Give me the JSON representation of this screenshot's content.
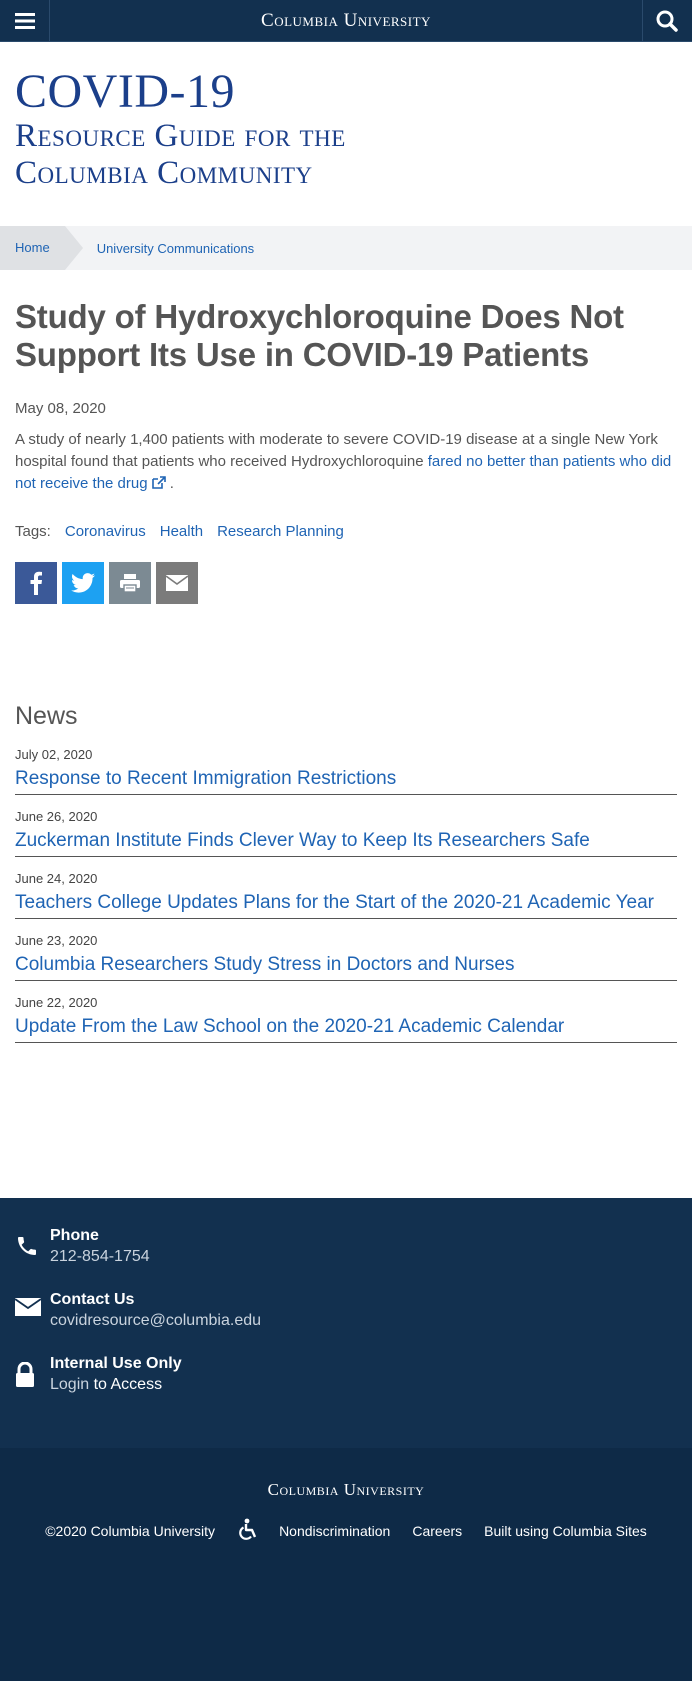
{
  "header": {
    "brand": "Columbia University",
    "icons": {
      "menu": "hamburger-menu-icon",
      "search": "search-icon"
    }
  },
  "site_title": {
    "line1": "COVID-19",
    "line2": "Resource Guide for the",
    "line3": "Columbia Community"
  },
  "breadcrumb": {
    "home": "Home",
    "current": "University Communications"
  },
  "article": {
    "title": "Study of Hydroxychloroquine Does Not Support Its Use in COVID-19 Patients",
    "date": "May 08, 2020",
    "body_text": "A study of nearly 1,400 patients with moderate to severe COVID-19 disease at a single New York hospital found that patients who received Hydroxychloroquine ",
    "body_link": "fared no better than patients who did not receive the drug",
    "body_end": ".",
    "tags_label": "Tags:",
    "tags": [
      "Coronavirus",
      "Health",
      "Research Planning"
    ]
  },
  "share": {
    "icons": [
      "facebook-icon",
      "twitter-icon",
      "print-icon",
      "email-icon"
    ]
  },
  "news": {
    "heading": "News",
    "items": [
      {
        "date": "July 02, 2020",
        "title": "Response to Recent Immigration Restrictions"
      },
      {
        "date": "June 26, 2020",
        "title": "Zuckerman Institute Finds Clever Way to Keep Its Researchers Safe"
      },
      {
        "date": "June 24, 2020",
        "title": "Teachers College Updates Plans for the Start of the 2020-21 Academic Year"
      },
      {
        "date": "June 23, 2020",
        "title": "Columbia Researchers Study Stress in Doctors and Nurses"
      },
      {
        "date": "June 22, 2020",
        "title": "Update From the Law School on the 2020-21 Academic Calendar"
      }
    ]
  },
  "contact": {
    "phone_label": "Phone",
    "phone_value": "212-854-1754",
    "contact_label": "Contact Us",
    "contact_value": "covidresource@columbia.edu",
    "internal_label": "Internal Use Only",
    "login_link": "Login",
    "login_suffix": " to Access"
  },
  "footer": {
    "brand": "Columbia University",
    "copyright": "©2020 Columbia University",
    "accessibility_icon": "accessibility-icon",
    "links": [
      "Nondiscrimination",
      "Careers",
      "Built using Columbia Sites"
    ]
  },
  "colors": {
    "navy": "#12304f",
    "footer_navy": "#0e2a47",
    "link_blue": "#1f64b4",
    "title_blue": "#1b3f8a"
  }
}
